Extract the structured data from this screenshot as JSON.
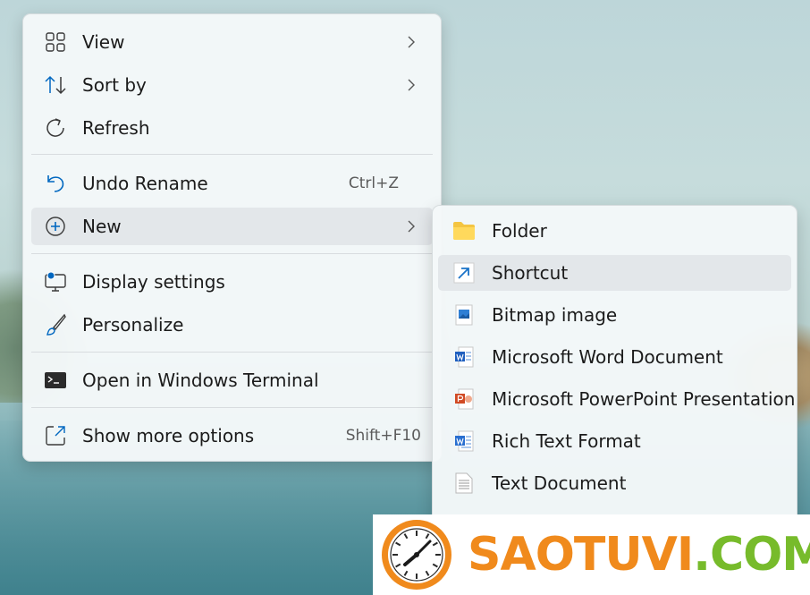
{
  "main_menu": {
    "items": [
      {
        "label": "View",
        "shortcut": "",
        "has_submenu": true,
        "icon": "grid-icon"
      },
      {
        "label": "Sort by",
        "shortcut": "",
        "has_submenu": true,
        "icon": "sort-icon"
      },
      {
        "label": "Refresh",
        "shortcut": "",
        "has_submenu": false,
        "icon": "refresh-icon"
      },
      {
        "label": "Undo Rename",
        "shortcut": "Ctrl+Z",
        "has_submenu": false,
        "icon": "undo-icon"
      },
      {
        "label": "New",
        "shortcut": "",
        "has_submenu": true,
        "icon": "plus-circle-icon"
      },
      {
        "label": "Display settings",
        "shortcut": "",
        "has_submenu": false,
        "icon": "display-icon"
      },
      {
        "label": "Personalize",
        "shortcut": "",
        "has_submenu": false,
        "icon": "brush-icon"
      },
      {
        "label": "Open in Windows Terminal",
        "shortcut": "",
        "has_submenu": false,
        "icon": "terminal-icon"
      },
      {
        "label": "Show more options",
        "shortcut": "Shift+F10",
        "has_submenu": false,
        "icon": "expand-icon"
      }
    ]
  },
  "sub_menu": {
    "items": [
      {
        "label": "Folder",
        "icon": "folder-icon"
      },
      {
        "label": "Shortcut",
        "icon": "shortcut-arrow-icon"
      },
      {
        "label": "Bitmap image",
        "icon": "bitmap-icon"
      },
      {
        "label": "Microsoft Word Document",
        "icon": "word-icon"
      },
      {
        "label": "Microsoft PowerPoint Presentation",
        "icon": "powerpoint-icon"
      },
      {
        "label": "Rich Text Format",
        "icon": "wordpad-icon"
      },
      {
        "label": "Text Document",
        "icon": "text-document-icon"
      }
    ]
  },
  "watermark": {
    "part1": "SAOTUVI",
    "part2": ".COM"
  },
  "colors": {
    "accent": "#0067c0",
    "watermark_orange": "#f08a1c",
    "watermark_green": "#77bb2b"
  }
}
